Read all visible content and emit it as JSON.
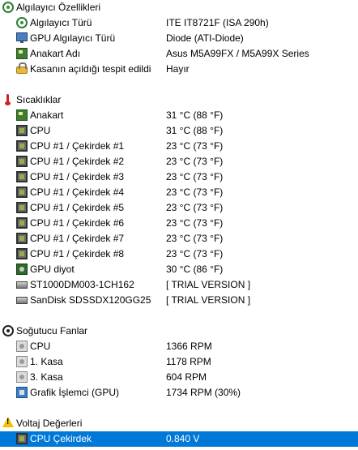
{
  "sensor_props": {
    "title": "Algılayıcı Özellikleri",
    "rows": [
      {
        "label": "Algılayıcı Türü",
        "value": "ITE IT8721F  (ISA 290h)",
        "icon": "sensor-icon"
      },
      {
        "label": "GPU Algılayıcı Türü",
        "value": "Diode  (ATI-Diode)",
        "icon": "monitor-icon"
      },
      {
        "label": "Anakart Adı",
        "value": "Asus M5A99FX / M5A99X Series",
        "icon": "motherboard-icon"
      },
      {
        "label": "Kasanın açıldığı tespit edildi",
        "value": "Hayır",
        "icon": "lock-icon"
      }
    ]
  },
  "temperatures": {
    "title": "Sıcaklıklar",
    "rows": [
      {
        "label": "Anakart",
        "value": "31 °C  (88 °F)",
        "icon": "motherboard-icon"
      },
      {
        "label": "CPU",
        "value": "31 °C  (88 °F)",
        "icon": "cpu-chip-icon"
      },
      {
        "label": "CPU #1 / Çekirdek #1",
        "value": "23 °C  (73 °F)",
        "icon": "cpu-chip-icon"
      },
      {
        "label": "CPU #1 / Çekirdek #2",
        "value": "23 °C  (73 °F)",
        "icon": "cpu-chip-icon"
      },
      {
        "label": "CPU #1 / Çekirdek #3",
        "value": "23 °C  (73 °F)",
        "icon": "cpu-chip-icon"
      },
      {
        "label": "CPU #1 / Çekirdek #4",
        "value": "23 °C  (73 °F)",
        "icon": "cpu-chip-icon"
      },
      {
        "label": "CPU #1 / Çekirdek #5",
        "value": "23 °C  (73 °F)",
        "icon": "cpu-chip-icon"
      },
      {
        "label": "CPU #1 / Çekirdek #6",
        "value": "23 °C  (73 °F)",
        "icon": "cpu-chip-icon"
      },
      {
        "label": "CPU #1 / Çekirdek #7",
        "value": "23 °C  (73 °F)",
        "icon": "cpu-chip-icon"
      },
      {
        "label": "CPU #1 / Çekirdek #8",
        "value": "23 °C  (73 °F)",
        "icon": "cpu-chip-icon"
      },
      {
        "label": "GPU diyot",
        "value": "30 °C  (86 °F)",
        "icon": "gpu-icon"
      },
      {
        "label": "ST1000DM003-1CH162",
        "value": "[ TRIAL VERSION ]",
        "icon": "hard-disk-icon"
      },
      {
        "label": "SanDisk SDSSDX120GG25",
        "value": "[ TRIAL VERSION ]",
        "icon": "hard-disk-icon"
      }
    ]
  },
  "fans": {
    "title": "Soğutucu Fanlar",
    "rows": [
      {
        "label": "CPU",
        "value": "1366 RPM",
        "icon": "fan-icon"
      },
      {
        "label": "1. Kasa",
        "value": "1178 RPM",
        "icon": "fan-icon"
      },
      {
        "label": "3. Kasa",
        "value": "604 RPM",
        "icon": "fan-icon"
      },
      {
        "label": "Grafik İşlemci (GPU)",
        "value": "1734 RPM  (30%)",
        "icon": "gpu-fan-icon"
      }
    ]
  },
  "voltages": {
    "title": "Voltaj Değerleri",
    "rows": [
      {
        "label": "CPU Çekirdek",
        "value": "0.840 V",
        "icon": "cpu-chip-icon",
        "selected": true
      }
    ]
  },
  "colors": {
    "selection": "#0078d7",
    "background": "#ffffff"
  }
}
